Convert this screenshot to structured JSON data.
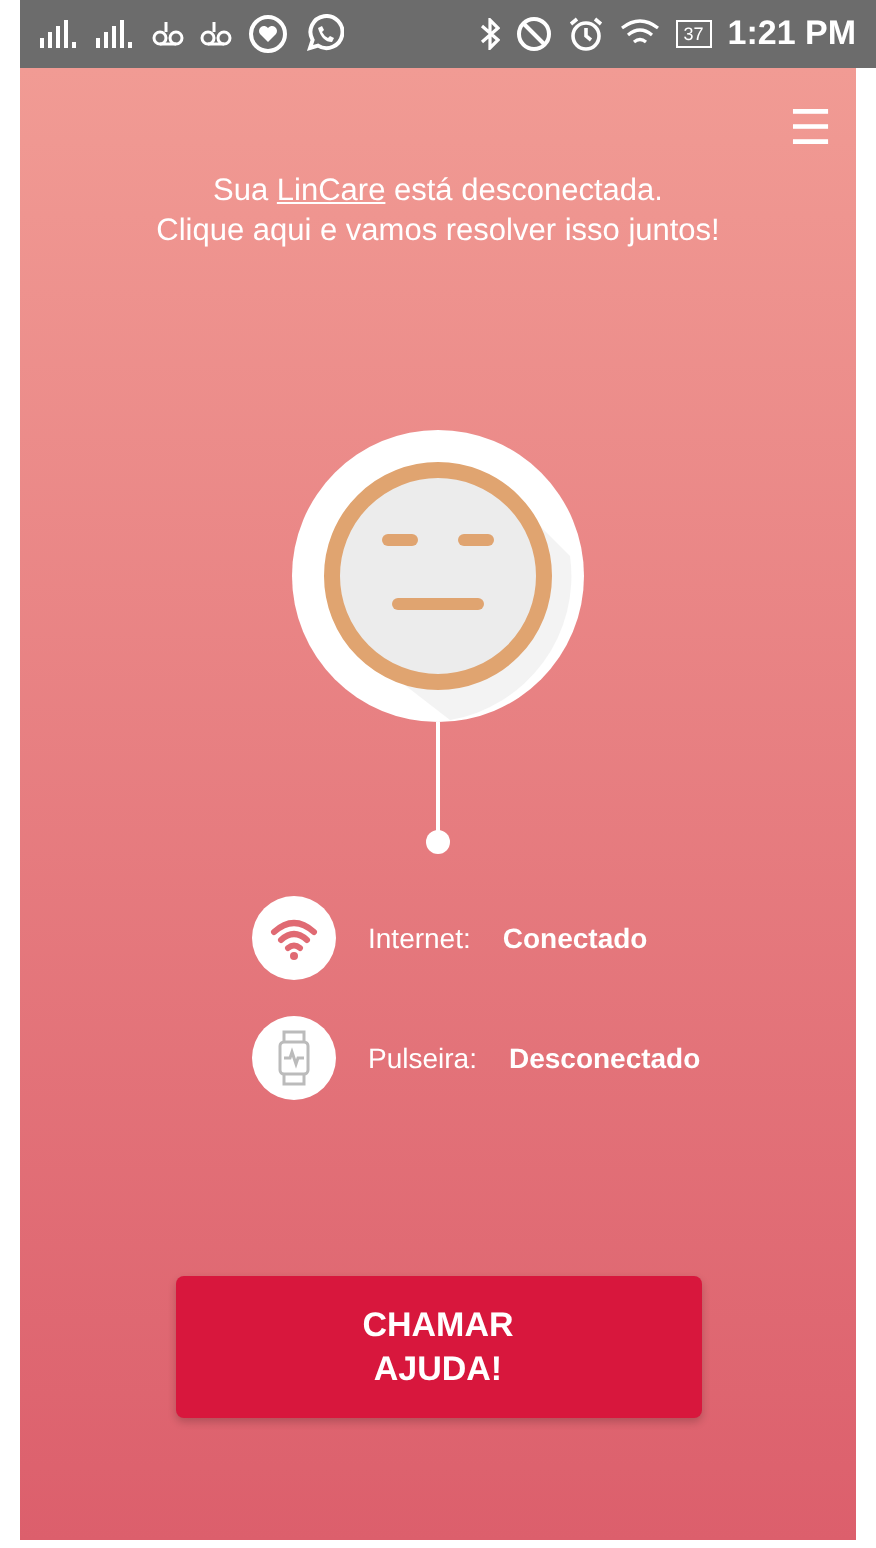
{
  "status_bar": {
    "battery": "37",
    "time": "1:21 PM"
  },
  "menu": {
    "icon": "☰"
  },
  "message": {
    "before": "Sua ",
    "link": "LinCare",
    "after": " está desconectada.",
    "line2": "Clique aqui e vamos resolver isso juntos!"
  },
  "connections": [
    {
      "kind": "wifi",
      "label": "Internet:",
      "value": "Conectado"
    },
    {
      "kind": "watch",
      "label": "Pulseira:",
      "value": "Desconectado"
    }
  ],
  "help_button": {
    "label": "CHAMAR AJUDA!"
  }
}
